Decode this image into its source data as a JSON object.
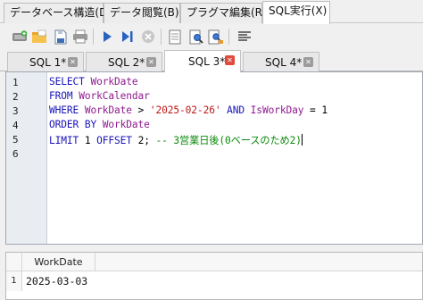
{
  "menu_tabs": [
    {
      "label": "データベース構造(D)",
      "active": false
    },
    {
      "label": "データ閲覧(B)",
      "active": false
    },
    {
      "label": "プラグマ編集(R)",
      "active": false
    },
    {
      "label": "SQL実行(X)",
      "active": true
    }
  ],
  "toolbar_icons": [
    "open-tab-icon",
    "open-sql-file-icon",
    "save-sql-file-icon",
    "print-icon",
    "execute-all-icon",
    "execute-line-icon",
    "stop-execution-icon",
    "save-results-icon",
    "find-icon",
    "find-replace-icon",
    "comment-block-icon"
  ],
  "sql_tabs": [
    {
      "label": "SQL 1*",
      "active": false,
      "close_color": "#9c9c9c"
    },
    {
      "label": "SQL 2*",
      "active": false,
      "close_color": "#9c9c9c"
    },
    {
      "label": "SQL 3*",
      "active": true,
      "close_color": "#e04a3a"
    },
    {
      "label": "SQL 4*",
      "active": false,
      "close_color": "#9c9c9c"
    }
  ],
  "editor": {
    "line_numbers": [
      "1",
      "2",
      "3",
      "4",
      "5",
      "6"
    ],
    "lines": [
      [
        {
          "t": "SELECT ",
          "c": "kw"
        },
        {
          "t": "WorkDate",
          "c": "id"
        }
      ],
      [
        {
          "t": "FROM ",
          "c": "kw"
        },
        {
          "t": "WorkCalendar",
          "c": "id"
        }
      ],
      [
        {
          "t": "WHERE ",
          "c": "kw"
        },
        {
          "t": "WorkDate",
          "c": "id"
        },
        {
          "t": " > ",
          "c": "op"
        },
        {
          "t": "'2025-02-26'",
          "c": "str"
        },
        {
          "t": " AND ",
          "c": "kw"
        },
        {
          "t": "IsWorkDay",
          "c": "id"
        },
        {
          "t": " = 1",
          "c": "op"
        }
      ],
      [
        {
          "t": "ORDER BY ",
          "c": "kw"
        },
        {
          "t": "WorkDate",
          "c": "id"
        }
      ],
      [
        {
          "t": "LIMIT ",
          "c": "kw"
        },
        {
          "t": "1",
          "c": "num"
        },
        {
          "t": " OFFSET ",
          "c": "kw"
        },
        {
          "t": "2",
          "c": "num"
        },
        {
          "t": "; ",
          "c": "op"
        },
        {
          "t": "-- 3営業日後(0ベースのため2)",
          "c": "cmt"
        }
      ],
      []
    ],
    "colors": {
      "keyword": "#1a14b8",
      "identifier": "#8e1a8e",
      "string": "#c01818",
      "comment": "#0d8a0d"
    }
  },
  "results": {
    "column_header": "WorkDate",
    "row_number": "1",
    "cell_value": "2025-03-03"
  }
}
